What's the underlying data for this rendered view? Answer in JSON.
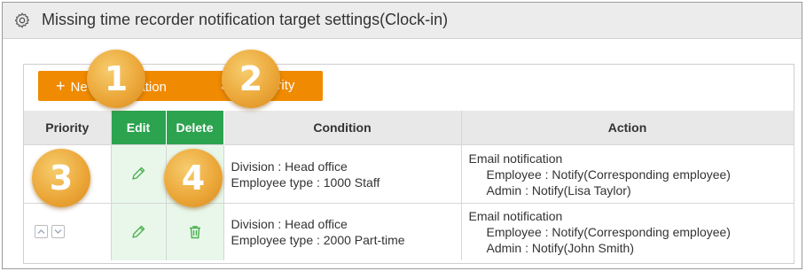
{
  "header": {
    "title": "Missing time recorder notification target settings(Clock-in)",
    "icon": "gear-icon"
  },
  "toolbar": {
    "new_label": "New registration",
    "save_label": "Save priority"
  },
  "table": {
    "columns": [
      "Priority",
      "Edit",
      "Delete",
      "Condition",
      "Action"
    ],
    "rows": [
      {
        "division": "Division :  Head office",
        "employee_type": "Employee type :  1000 Staff",
        "action_title": "Email notification",
        "employee_notify": "Employee :  Notify(Corresponding employee)",
        "admin_notify": "Admin :  Notify(Lisa Taylor)"
      },
      {
        "division": "Division :  Head office",
        "employee_type": "Employee type :  2000 Part-time",
        "action_title": "Email notification",
        "employee_notify": "Employee :  Notify(Corresponding employee)",
        "admin_notify": "Admin :  Notify(John Smith)"
      }
    ]
  },
  "callouts": [
    "1",
    "2",
    "3",
    "4"
  ],
  "colors": {
    "accent": "#f08a00",
    "green": "#2ca34f",
    "green_light": "#e8f7ea",
    "badge": "#eca83a"
  }
}
